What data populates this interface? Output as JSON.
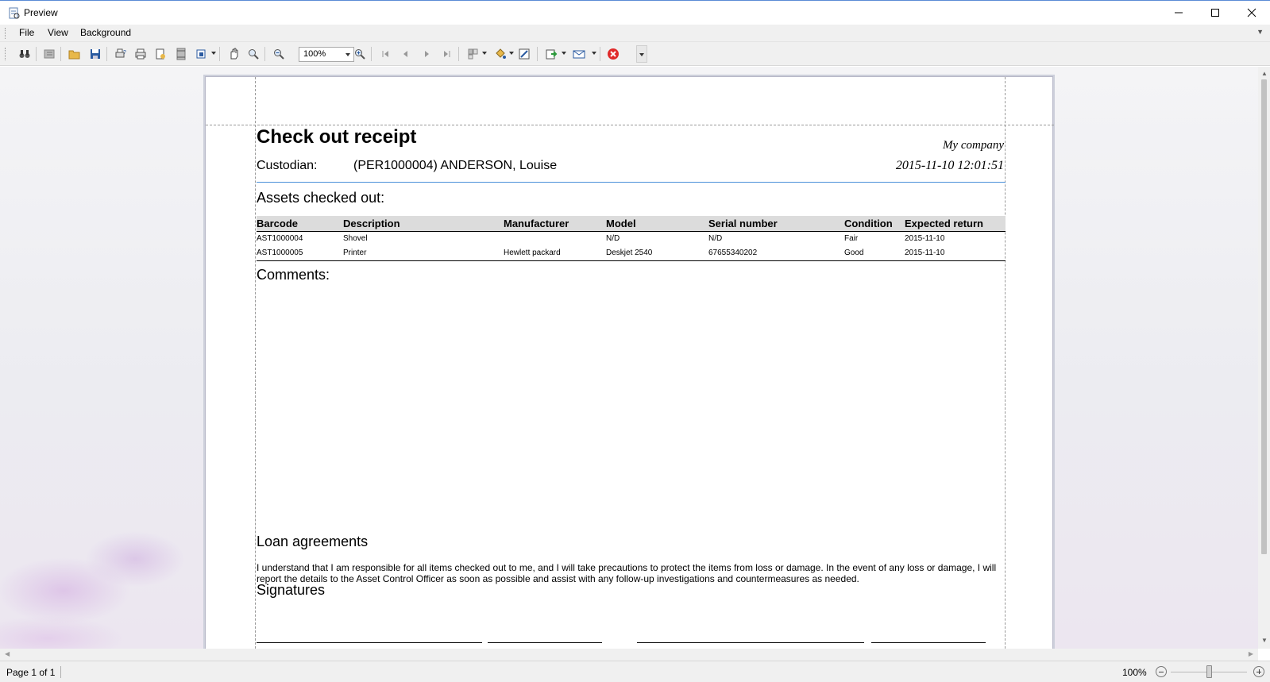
{
  "window": {
    "title": "Preview"
  },
  "menu": {
    "file": "File",
    "view": "View",
    "background": "Background"
  },
  "toolbar": {
    "zoom_value": "100%"
  },
  "report": {
    "title": "Check out receipt",
    "company": "My company",
    "timestamp": "2015-11-10 12:01:51",
    "custodian_label": "Custodian:",
    "custodian_value": "(PER1000004) ANDERSON, Louise",
    "assets_heading": "Assets checked out:",
    "columns": [
      "Barcode",
      "Description",
      "Manufacturer",
      "Model",
      "Serial number",
      "Condition",
      "Expected return"
    ],
    "rows": [
      [
        "AST1000004",
        "Shovel",
        "",
        "N/D",
        "N/D",
        "Fair",
        "2015-11-10"
      ],
      [
        "AST1000005",
        "Printer",
        "Hewlett packard",
        "Deskjet 2540",
        "67655340202",
        "Good",
        "2015-11-10"
      ]
    ],
    "comments_heading": "Comments:",
    "loan_heading": "Loan agreements",
    "loan_text": "I understand that I am responsible for all items checked out to me, and I will take precautions to protect the items from loss or damage. In the event of any loss or damage, I will report the details to the Asset Control Officer as soon as possible and assist with any follow-up investigations and countermeasures as needed.",
    "signatures_heading": "Signatures"
  },
  "status": {
    "page": "Page 1 of 1",
    "zoom": "100%"
  }
}
